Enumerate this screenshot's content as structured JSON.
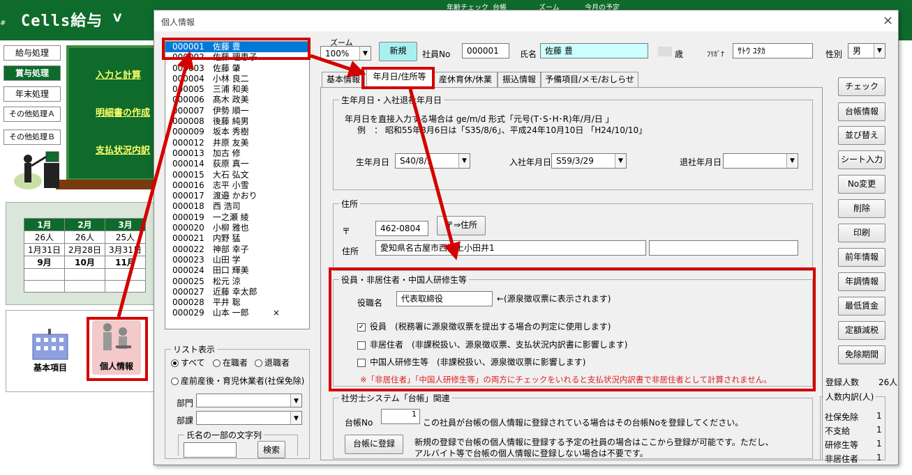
{
  "background_app": {
    "title": "Cells給与",
    "version": "V",
    "hash": "#",
    "top_menu": [
      "年齢チェック",
      "台帳",
      "ズーム",
      "今月の予定"
    ],
    "left_buttons": [
      "給与処理",
      "賞与処理",
      "年末処理",
      "その他処理Ａ",
      "その他処理Ｂ"
    ],
    "board_links": [
      "入力と計算",
      "明細書の作成",
      "支払状況内訳"
    ],
    "calendar": {
      "months": [
        "1月",
        "2月",
        "3月"
      ],
      "counts": [
        "26人",
        "26人",
        "25人"
      ],
      "dates": [
        "1月31日",
        "2月28日",
        "3月31日"
      ],
      "next": [
        "9月",
        "10月",
        "11月"
      ]
    },
    "icons": {
      "basic": "基本項目",
      "personal": "個人情報"
    }
  },
  "dialog": {
    "title": "個人情報",
    "close": "×",
    "zoom_label": "ズーム",
    "zoom_value": "100%",
    "new_button": "新規",
    "emp_no_label": "社員No",
    "emp_no_value": "000001",
    "name_label": "氏名",
    "name_value": "佐藤 豊",
    "age_unit": "歳",
    "kana_label": "ﾌﾘｶﾞﾅ",
    "kana_value": "ｻﾄｳ ﾕﾀｶ",
    "sex_label": "性別",
    "sex_value": "男",
    "tabs": [
      "基本情報",
      "年月日/住所等",
      "産休育休/休業",
      "振込情報",
      "予備項目/メモ/おしらせ等"
    ],
    "employees": [
      {
        "no": "000001",
        "name": "佐藤 豊"
      },
      {
        "no": "000002",
        "name": "佐藤 理恵子"
      },
      {
        "no": "000003",
        "name": "佐藤 肇"
      },
      {
        "no": "000004",
        "name": "小林 良二"
      },
      {
        "no": "000005",
        "name": "三浦 和美"
      },
      {
        "no": "000006",
        "name": "髙木 政美"
      },
      {
        "no": "000007",
        "name": "伊勢 順一"
      },
      {
        "no": "000008",
        "name": "後藤 純男"
      },
      {
        "no": "000009",
        "name": "坂本 秀樹"
      },
      {
        "no": "000012",
        "name": "井原 友美"
      },
      {
        "no": "000013",
        "name": "加古 修"
      },
      {
        "no": "000014",
        "name": "荻原 真一"
      },
      {
        "no": "000015",
        "name": "大石 弘文"
      },
      {
        "no": "000016",
        "name": "志平 小雪"
      },
      {
        "no": "000017",
        "name": "渡邉 かおり"
      },
      {
        "no": "000018",
        "name": "西 浩司"
      },
      {
        "no": "000019",
        "name": "一之瀬 綾"
      },
      {
        "no": "000020",
        "name": "小柳 雅也"
      },
      {
        "no": "000021",
        "name": "内野 猛"
      },
      {
        "no": "000022",
        "name": "神部 幸子"
      },
      {
        "no": "000023",
        "name": "山田 学"
      },
      {
        "no": "000024",
        "name": "田口 輝美"
      },
      {
        "no": "000025",
        "name": "松元 涼"
      },
      {
        "no": "000027",
        "name": "近藤 幸太郎"
      },
      {
        "no": "000028",
        "name": "平井 聡"
      },
      {
        "no": "000029",
        "name": "山本 一郎"
      }
    ],
    "retired_mark": "×",
    "list_display": {
      "title": "リスト表示",
      "options": [
        "すべて",
        "在職者",
        "退職者"
      ],
      "option_leave": "産前産後・育児休業者(社保免除)",
      "dept_label": "部門",
      "section_label": "部課",
      "name_search_title": "氏名の一部の文字列",
      "search_button": "検索"
    },
    "dates_group": {
      "title": "生年月日・入社退社年月日",
      "note1": "年月日を直接入力する場合は ge/m/d  形式「元号(T･S･H･R)年/月/日 」",
      "note2": "例　：  昭和55年8月6日は「S35/8/6」、平成24年10月10日 「H24/10/10」",
      "birth_label": "生年月日",
      "birth_value": "S40/8/1",
      "join_label": "入社年月日",
      "join_value": "S59/3/29",
      "leave_label": "退社年月日",
      "leave_value": ""
    },
    "address_group": {
      "title": "住所",
      "postal_mark": "〒",
      "postal_value": "462-0804",
      "postal_button": "〒⇒住所",
      "address_label": "住所",
      "address_value": "愛知県名古屋市西区上小田井1",
      "address2_value": ""
    },
    "officer_group": {
      "title": "役員・非居住者・中国人研修生等",
      "role_label": "役職名",
      "role_value": "代表取締役",
      "role_note": "←(源泉徴収票に表示されます)",
      "checks": [
        {
          "label": "役員",
          "note": "(税務署に源泉徴収票を提出する場合の判定に使用します)",
          "checked": true
        },
        {
          "label": "非居住者",
          "note": "(非課税扱い、源泉徴収票、支払状況内訳書に影響します)",
          "checked": false
        },
        {
          "label": "中国人研修生等",
          "note": "(非課税扱い、源泉徴収票に影響します)",
          "checked": false
        }
      ],
      "warning": "※「非居住者」「中国人研修生等」の両方にチェックをいれると支払状況内訳書で非居住者として計算されません。"
    },
    "labor_group": {
      "title": "社労士システム「台帳」関連",
      "ledger_no_label": "台帳No",
      "ledger_no_value": "1",
      "ledger_note": "この社員が台帳の個人情報に登録されている場合はその台帳Noを登録してください。",
      "register_button": "台帳に登録",
      "register_note1": "新規の登録で台帳の個人情報に登録する予定の社員の場合はここから登録が可能です。ただし、",
      "register_note2": "アルバイト等で台帳の個人情報に登録しない場合は不要です。"
    },
    "side_buttons": [
      "チェック",
      "台帳情報",
      "並び替え",
      "シート入力",
      "No変更",
      "削除",
      "印刷",
      "前年情報",
      "年調情報",
      "最低賃金",
      "定額減税",
      "免除期間"
    ],
    "registered_label": "登録人数",
    "registered_value": "26人",
    "breakdown": {
      "title": "人数内訳(人)",
      "rows": [
        {
          "label": "社保免除",
          "value": "1"
        },
        {
          "label": "不支給",
          "value": "1"
        },
        {
          "label": "研修生等",
          "value": "1"
        },
        {
          "label": "非居住者",
          "value": "1"
        }
      ]
    }
  },
  "colors": {
    "accent_red": "#d40000",
    "board_green": "#0e6b2c",
    "selection_blue": "#0078d7",
    "warning_text": "#e02020"
  }
}
